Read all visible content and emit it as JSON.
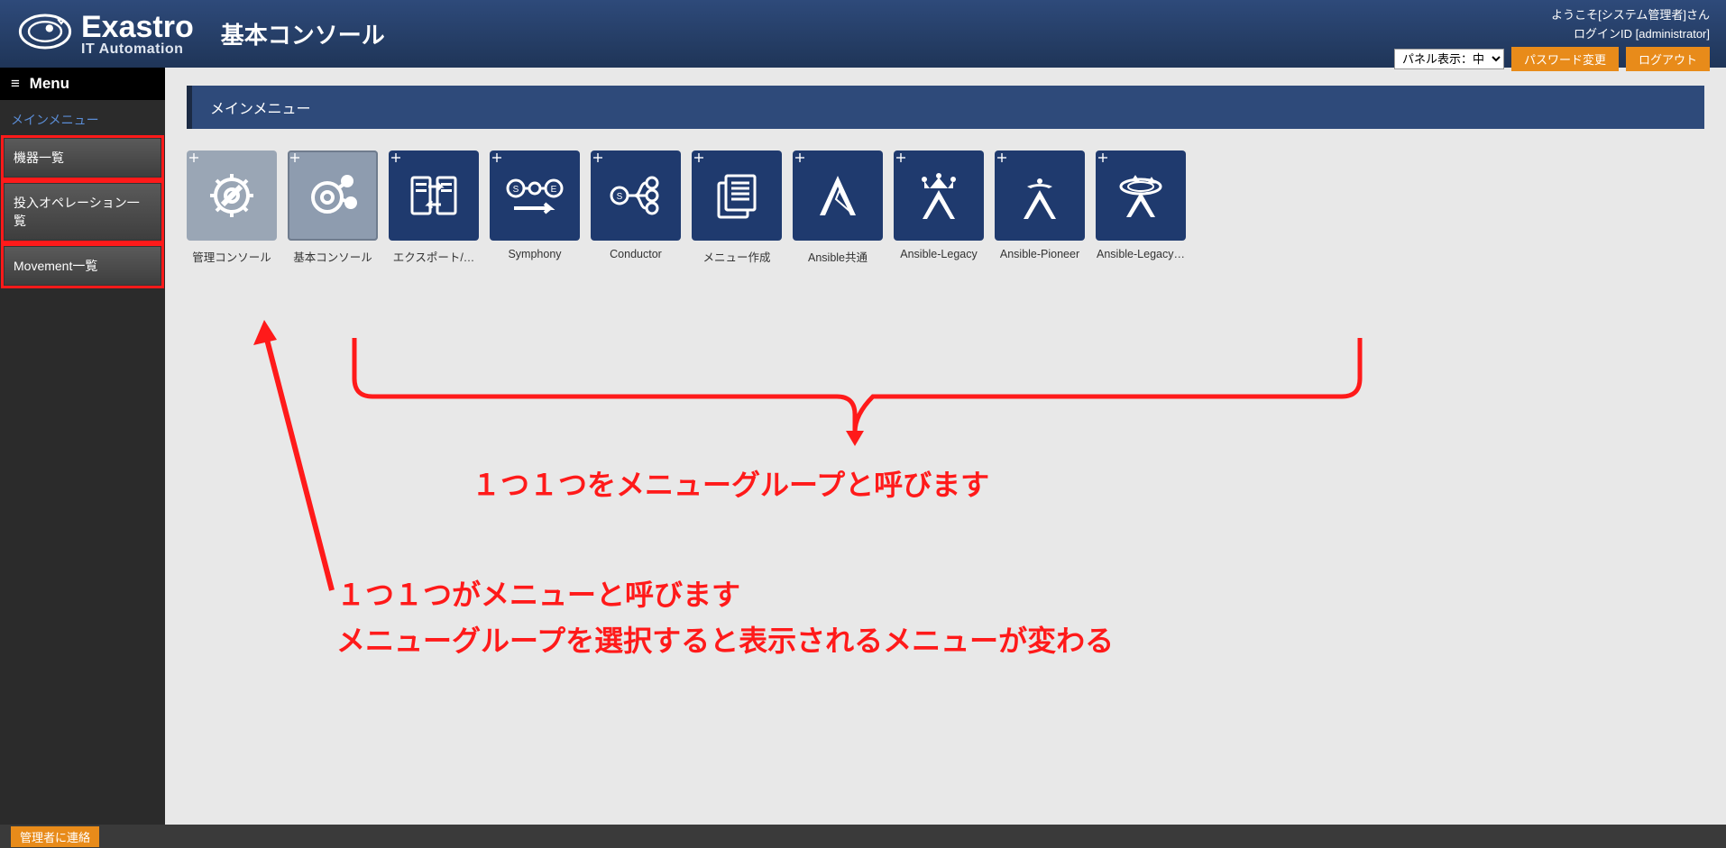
{
  "header": {
    "logo_main": "Exastro",
    "logo_sub": "IT Automation",
    "page_title": "基本コンソール",
    "welcome": "ようこそ[システム管理者]さん",
    "login_id": "ログインID [administrator]",
    "panel_select_label": "パネル表示：中",
    "btn_pw": "パスワード変更",
    "btn_logout": "ログアウト"
  },
  "sidebar": {
    "menu_label": "Menu",
    "section_label": "メインメニュー",
    "items": [
      {
        "label": "機器一覧"
      },
      {
        "label": "投入オペレーション一覧"
      },
      {
        "label": "Movement一覧"
      }
    ]
  },
  "content": {
    "header": "メインメニュー",
    "panels": [
      {
        "label": "管理コンソール",
        "variant": "light"
      },
      {
        "label": "基本コンソール",
        "variant": "selected"
      },
      {
        "label": "エクスポート/…",
        "variant": "dark"
      },
      {
        "label": "Symphony",
        "variant": "dark"
      },
      {
        "label": "Conductor",
        "variant": "dark"
      },
      {
        "label": "メニュー作成",
        "variant": "dark"
      },
      {
        "label": "Ansible共通",
        "variant": "dark"
      },
      {
        "label": "Ansible-Legacy",
        "variant": "dark"
      },
      {
        "label": "Ansible-Pioneer",
        "variant": "dark"
      },
      {
        "label": "Ansible-Legacy…",
        "variant": "dark"
      }
    ]
  },
  "annotations": {
    "group_text": "１つ１つをメニューグループと呼びます",
    "menu_text_1": "１つ１つがメニューと呼びます",
    "menu_text_2": "メニューグループを選択すると表示されるメニューが変わる"
  },
  "footer": {
    "contact_btn": "管理者に連絡"
  }
}
